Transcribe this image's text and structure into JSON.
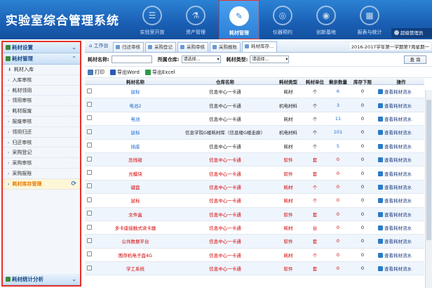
{
  "app_title": "实验室综合管理系统",
  "nav": [
    {
      "label": "实验室开放",
      "icon": "form-icon"
    },
    {
      "label": "资产管理",
      "icon": "microscope-icon"
    },
    {
      "label": "耗材管理",
      "icon": "pencil-icon",
      "active": true
    },
    {
      "label": "仪器预约",
      "icon": "satellite-icon"
    },
    {
      "label": "创新基地",
      "icon": "globe-icon"
    },
    {
      "label": "报表与统计",
      "icon": "chart-icon"
    }
  ],
  "user_label": "超级管理员",
  "sidebar": {
    "section1": "耗材设置",
    "section2": "耗材管理",
    "items": [
      "耗材入库",
      "入库审核",
      "耗材领用",
      "领用审核",
      "耗材报废",
      "报废审核",
      "领用归还",
      "归还审核",
      "采购登记",
      "采购审核",
      "采购报账",
      "耗材库存管理"
    ],
    "active_index": 11,
    "section3": "耗材统计分析"
  },
  "tabs": {
    "home": "工作台",
    "list": [
      "归还审核",
      "采购登记",
      "采购审核",
      "采购报账",
      "耗材库存..."
    ],
    "active_index": 4,
    "semester": "2016-2017学年第一学期第7周星期一"
  },
  "filter": {
    "name_label": "耗材名称:",
    "store_label": "所属仓库:",
    "store_value": "请选择...",
    "type_label": "耗材类型:",
    "type_value": "请选择...",
    "query_button": "查 询"
  },
  "toolbar": {
    "print": "打印",
    "export_word": "导出Word",
    "export_excel": "导出Excel"
  },
  "columns": [
    "耗材名称",
    "仓库名称",
    "耗材类型",
    "耗材单位",
    "剩余数量",
    "库存下限",
    "操作"
  ],
  "rows": [
    {
      "name": "鼠标",
      "store": "信息中心一卡通",
      "type": "耗材",
      "unit": "个",
      "qty": "6",
      "min": "0",
      "color": "blue"
    },
    {
      "name": "电池2",
      "store": "信息中心一卡通",
      "type": "机电材料",
      "unit": "个",
      "qty": "3",
      "min": "0",
      "color": "blue"
    },
    {
      "name": "电池",
      "store": "信息中心一卡通",
      "type": "耗材",
      "unit": "个",
      "qty": "11",
      "min": "0",
      "color": "blue"
    },
    {
      "name": "鼠标",
      "store": "信息学院G楼耗材库（信息楼G楼走廊）",
      "type": "机电材料",
      "unit": "个",
      "qty": "101",
      "min": "0",
      "color": "blue"
    },
    {
      "name": "插座",
      "store": "信息中心一卡通",
      "type": "耗材",
      "unit": "个",
      "qty": "5",
      "min": "0",
      "color": "blue"
    },
    {
      "name": "压线钳",
      "store": "信息中心一卡通",
      "type": "软件",
      "unit": "套",
      "qty": "0",
      "min": "0",
      "color": "red"
    },
    {
      "name": "光模块",
      "store": "信息中心一卡通",
      "type": "软件",
      "unit": "套",
      "qty": "0",
      "min": "0",
      "color": "red"
    },
    {
      "name": "键盘",
      "store": "信息中心一卡通",
      "type": "耗材",
      "unit": "个",
      "qty": "0",
      "min": "0",
      "color": "red"
    },
    {
      "name": "鼠标",
      "store": "信息中心一卡通",
      "type": "耗材",
      "unit": "个",
      "qty": "0",
      "min": "0",
      "color": "red"
    },
    {
      "name": "文件盒",
      "store": "信息中心一卡通",
      "type": "软件",
      "unit": "套",
      "qty": "0",
      "min": "0",
      "color": "red"
    },
    {
      "name": "多卡座接触式读卡器",
      "store": "信息中心一卡通",
      "type": "耗材",
      "unit": "台",
      "qty": "0",
      "min": "0",
      "color": "red"
    },
    {
      "name": "公共数据平台",
      "store": "信息中心一卡通",
      "type": "软件",
      "unit": "套",
      "qty": "0",
      "min": "0",
      "color": "red"
    },
    {
      "name": "图存机电子盘4G",
      "store": "信息中心一卡通",
      "type": "耗材",
      "unit": "个",
      "qty": "0",
      "min": "0",
      "color": "red"
    },
    {
      "name": "学工系统",
      "store": "信息中心一卡通",
      "type": "软件",
      "unit": "套",
      "qty": "0",
      "min": "0",
      "color": "red"
    }
  ],
  "row_action": "查看耗材流水"
}
